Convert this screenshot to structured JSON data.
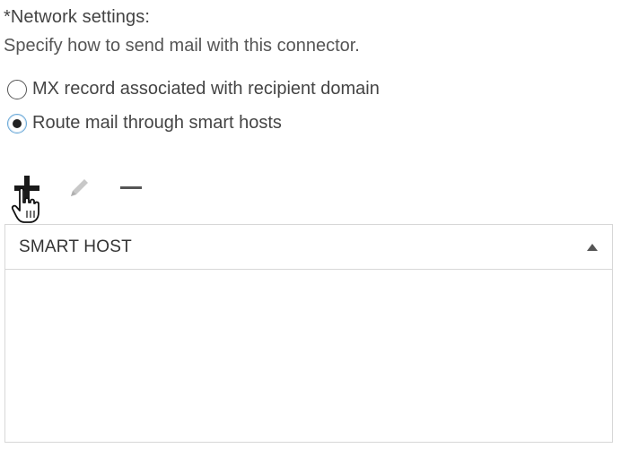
{
  "network": {
    "title": "*Network settings:",
    "description": "Specify how to send mail with this connector.",
    "options": [
      {
        "label": "MX record associated with recipient domain",
        "checked": false
      },
      {
        "label": "Route mail through smart hosts",
        "checked": true
      }
    ]
  },
  "toolbar": {
    "add_icon": "plus-icon",
    "edit_icon": "pencil-icon",
    "remove_icon": "minus-icon"
  },
  "grid": {
    "columns": [
      {
        "label": "SMART HOST",
        "sort": "ascending"
      }
    ],
    "rows": []
  },
  "cursor": "hand-pointer-icon",
  "colors": {
    "selected_radio_border": "#6aa9d8",
    "grid_border": "#d7d7d7"
  }
}
